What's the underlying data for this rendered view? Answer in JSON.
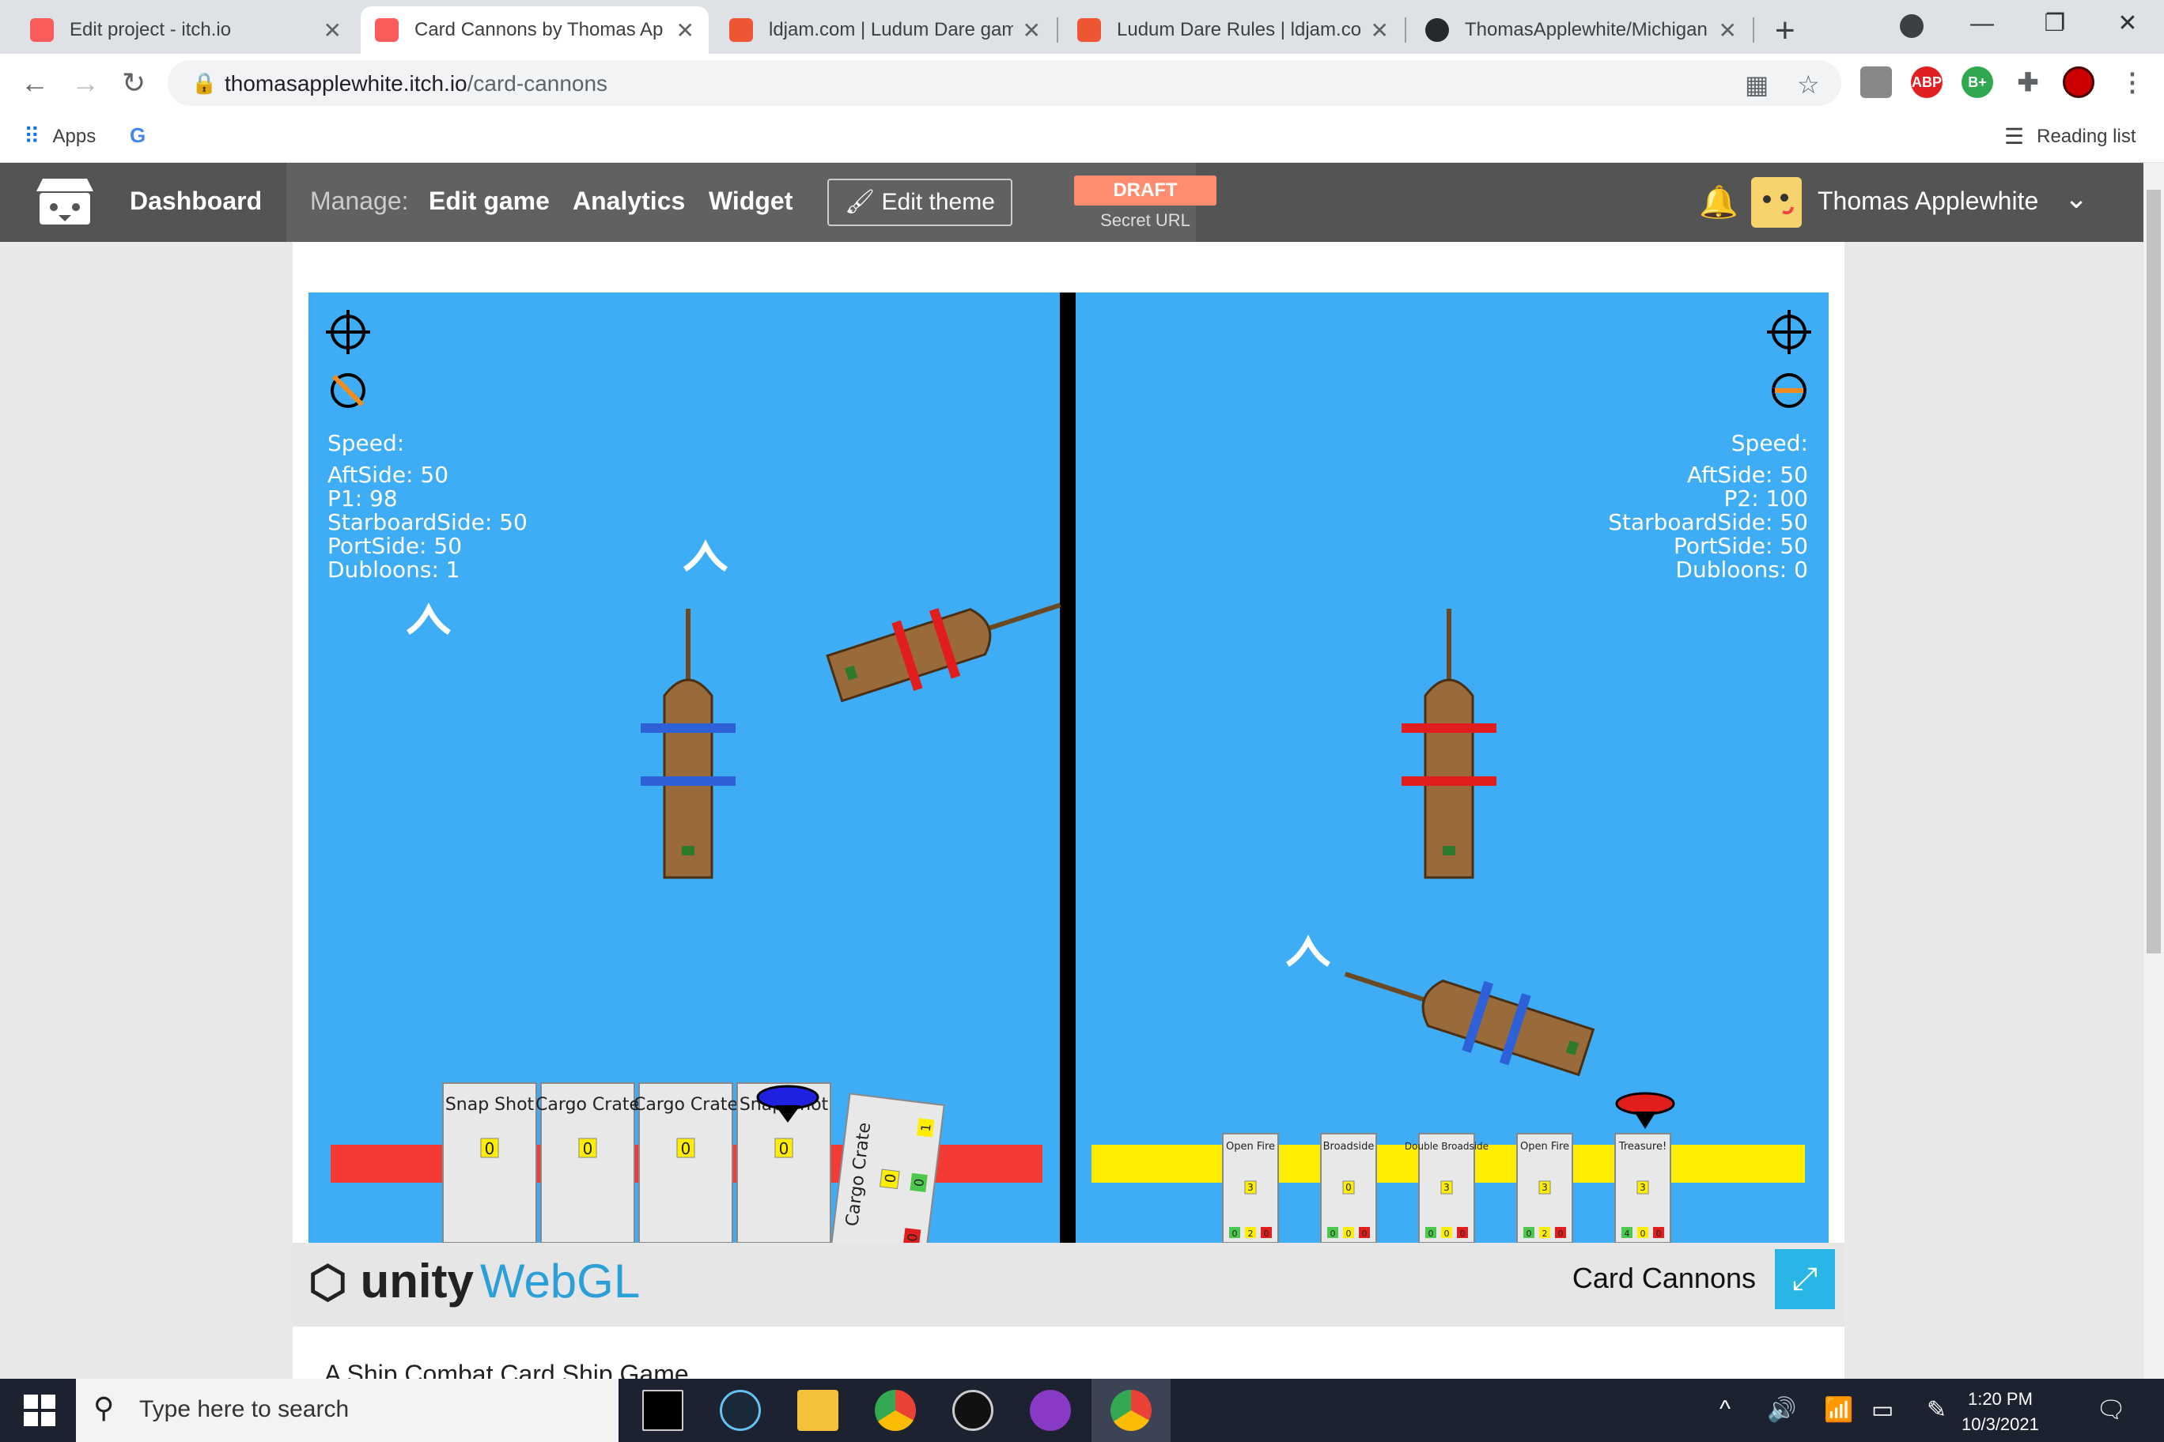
{
  "browser": {
    "tabs": [
      {
        "title": "Edit project - itch.io",
        "favicon_color": "#fa5c5c"
      },
      {
        "title": "Card Cannons by Thomas Ap",
        "favicon_color": "#fa5c5c",
        "active": true
      },
      {
        "title": "ldjam.com | Ludum Dare gam",
        "favicon_color": "#ee5533"
      },
      {
        "title": "Ludum Dare Rules | ldjam.co",
        "favicon_color": "#ee5533"
      },
      {
        "title": "ThomasApplewhite/Michigan",
        "favicon_color": "#24292e"
      }
    ],
    "url_domain": "thomasapplewhite.itch.io",
    "url_path": "/card-cannons",
    "bookmarks": {
      "apps": "Apps",
      "reading_list": "Reading list"
    },
    "extensions": [
      {
        "label": "ABP",
        "color": "#e02020"
      },
      {
        "label": "B+",
        "color": "#2fa84f"
      }
    ]
  },
  "itch": {
    "dashboard": "Dashboard",
    "manage": "Manage:",
    "links": [
      "Edit game",
      "Analytics",
      "Widget"
    ],
    "edit_theme": "Edit theme",
    "draft": "DRAFT",
    "secret_url": "Secret URL",
    "username": "Thomas Applewhite"
  },
  "game": {
    "title": "Card Cannons",
    "description": "A Ship Combat Card Ship Game",
    "engine_logo": "unity",
    "engine_logo_suffix": "WebGL",
    "ocean_color": "#3fadf5",
    "player1": {
      "speed_label": "Speed:",
      "stats": [
        "AftSide: 50",
        "P1: 98",
        "StarboardSide: 50",
        "PortSide: 50",
        "Dubloons: 1"
      ],
      "bar_color": "#f33a34",
      "cards": [
        {
          "name": "Snap Shot",
          "cost": "0"
        },
        {
          "name": "Cargo Crate",
          "cost": "0"
        },
        {
          "name": "Cargo Crate",
          "cost": "0"
        },
        {
          "name": "Snap Shot",
          "cost": "0"
        }
      ],
      "held_card": {
        "name": "Cargo Crate",
        "cost": "0",
        "values": [
          "0",
          "0",
          "1"
        ]
      }
    },
    "player2": {
      "speed_label": "Speed:",
      "stats": [
        "AftSide: 50",
        "P2: 100",
        "StarboardSide: 50",
        "PortSide: 50",
        "Dubloons: 0"
      ],
      "bar_color": "#ffee00",
      "cards": [
        {
          "name": "Open Fire",
          "cost": "3",
          "values": [
            "0",
            "2",
            "0"
          ]
        },
        {
          "name": "Broadside",
          "cost": "0",
          "values": [
            "0",
            "0",
            "0"
          ]
        },
        {
          "name": "Double Broadside",
          "cost": "3",
          "values": [
            "0",
            "0",
            "0"
          ]
        },
        {
          "name": "Open Fire",
          "cost": "3",
          "values": [
            "0",
            "2",
            "0"
          ]
        },
        {
          "name": "Treasure!",
          "cost": "3",
          "values": [
            "4",
            "0",
            "0"
          ]
        }
      ]
    }
  },
  "taskbar": {
    "search_placeholder": "Type here to search",
    "time": "1:20 PM",
    "date": "10/3/2021"
  }
}
